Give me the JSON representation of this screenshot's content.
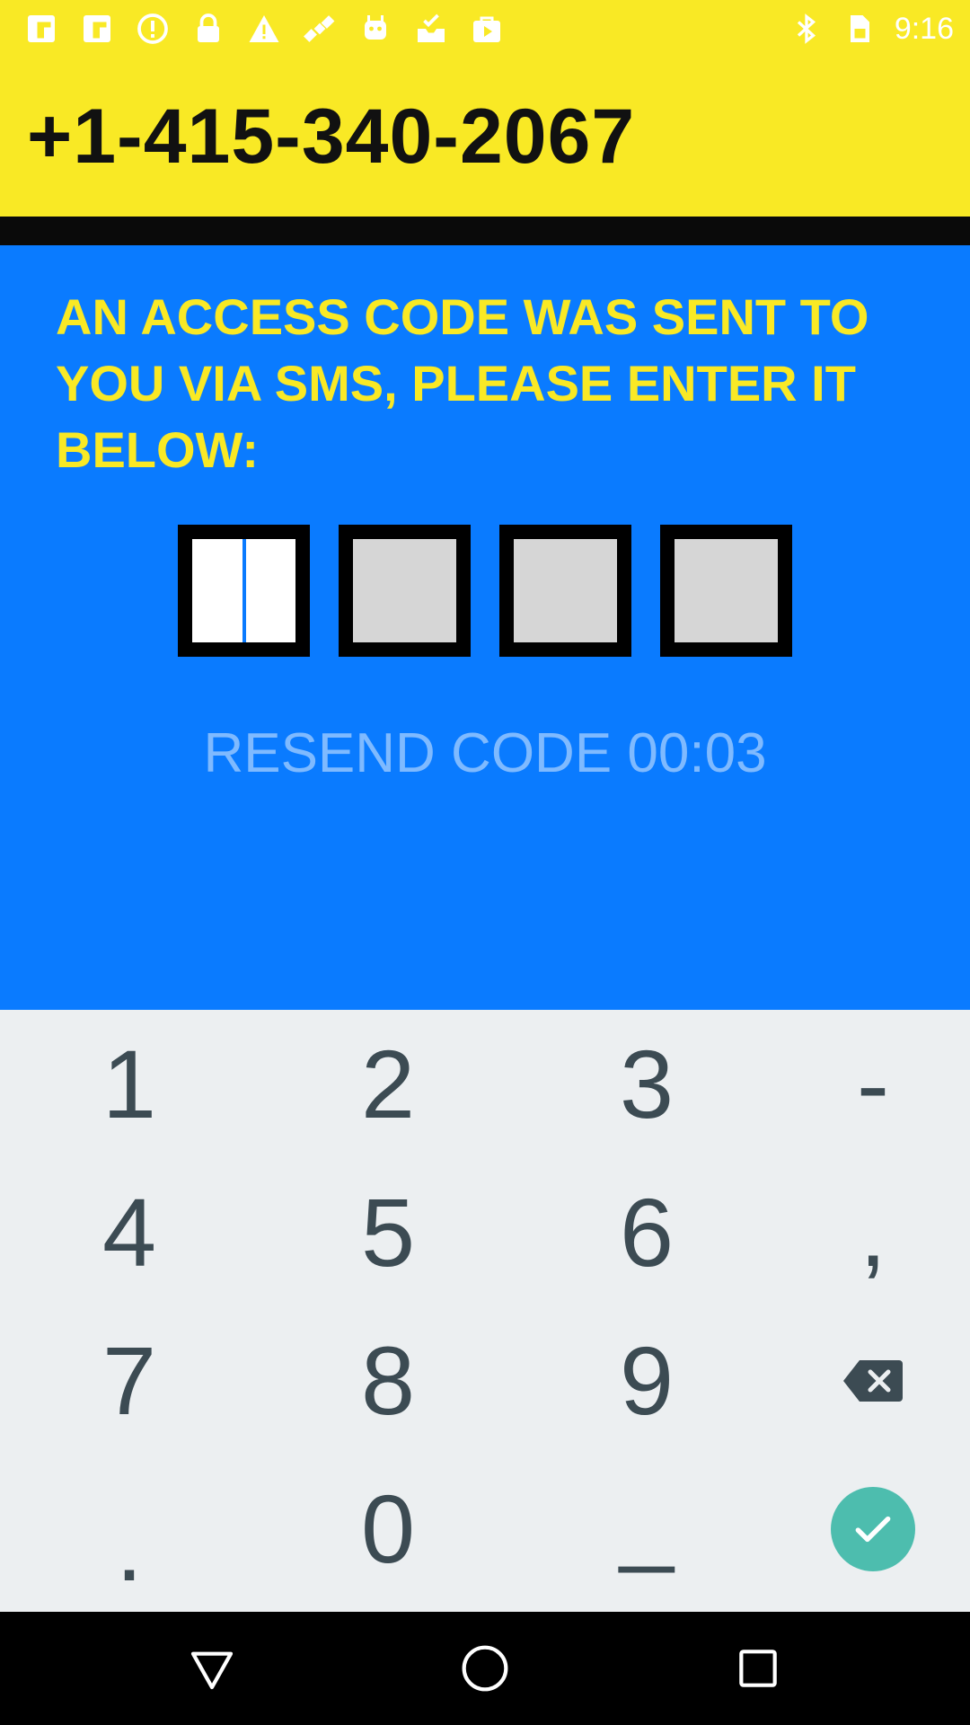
{
  "status_bar": {
    "left_icons": [
      "flipboard-icon",
      "flipboard-icon",
      "alert-circle-icon",
      "lock-icon",
      "warning-icon",
      "satellite-icon",
      "android-icon",
      "inbox-check-icon",
      "play-store-icon"
    ],
    "right_icons": [
      "bluetooth-icon",
      "sim-card-icon"
    ],
    "time": "9:16"
  },
  "header": {
    "phone_number": "+1-415-340-2067"
  },
  "main": {
    "instruction": "AN ACCESS CODE WAS SENT TO YOU VIA SMS, PLEASE ENTER IT BELOW:",
    "code_boxes": [
      "",
      "",
      "",
      ""
    ],
    "resend_label": "RESEND CODE 00:03"
  },
  "keyboard": {
    "keys": [
      "1",
      "2",
      "3",
      "-",
      "4",
      "5",
      "6",
      ",",
      "7",
      "8",
      "9",
      "backspace",
      ".",
      "0",
      "_",
      "enter"
    ]
  },
  "nav_bar": {
    "buttons": [
      "back-icon",
      "home-icon",
      "recents-icon"
    ]
  },
  "colors": {
    "header_yellow": "#f9e925",
    "main_blue": "#0a7bff",
    "resend_text": "#7fbaff",
    "keyboard_bg": "#eceff1",
    "enter_teal": "#4dbdae"
  }
}
